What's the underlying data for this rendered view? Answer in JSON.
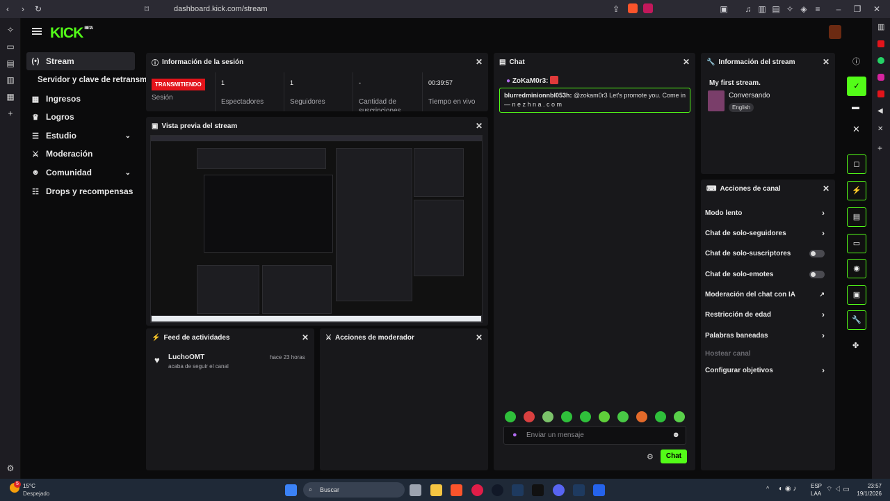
{
  "browser": {
    "url": "dashboard.kick.com/stream"
  },
  "brand": {
    "logo": "KICK",
    "badge": "BETA",
    "accent": "#53fc18"
  },
  "sidebar": {
    "items": [
      {
        "label": "Stream",
        "icon": "broadcast-icon"
      },
      {
        "label": "Servidor y clave de retransm",
        "icon": ""
      },
      {
        "label": "Ingresos",
        "icon": "chart-icon"
      },
      {
        "label": "Logros",
        "icon": "trophy-icon"
      },
      {
        "label": "Estudio",
        "icon": "sliders-icon"
      },
      {
        "label": "Moderación",
        "icon": "sword-icon"
      },
      {
        "label": "Comunidad",
        "icon": "users-icon"
      },
      {
        "label": "Drops y recompensas",
        "icon": "list-icon"
      }
    ]
  },
  "session": {
    "title": "Información de la sesión",
    "status": "TRANSMITIENDO",
    "status_label": "Sesión",
    "viewers_value": "1",
    "viewers_label": "Espectadores",
    "followers_value": "1",
    "followers_label": "Seguidores",
    "subs_value": "-",
    "subs_label": "Cantidad de suscripciones",
    "time_value": "00:39:57",
    "time_label": "Tiempo en vivo"
  },
  "preview": {
    "title": "Vista previa del stream"
  },
  "feed": {
    "title": "Feed de actividades",
    "user": "LuchoOMT",
    "action": "acaba de seguir el canal",
    "time": "hace 23 horas"
  },
  "modactions": {
    "title": "Acciones de moderador"
  },
  "chat": {
    "title": "Chat",
    "pinned_user": "ZoKaM0r3:",
    "msg_user": "blurredminionnbl053h:",
    "msg_text": "@zokam0r3 Let's promote you. Come in — n e z h n a . c o m",
    "placeholder": "Enviar un mensaje",
    "send": "Chat"
  },
  "stream_info": {
    "title": "Información del stream",
    "stream_title": "My first stream.",
    "category": "Conversando",
    "language": "English"
  },
  "channel_actions": {
    "title": "Acciones de canal",
    "items": [
      {
        "label": "Modo lento",
        "kind": "arrow"
      },
      {
        "label": "Chat de solo-seguidores",
        "kind": "arrow"
      },
      {
        "label": "Chat de solo-suscriptores",
        "kind": "toggle"
      },
      {
        "label": "Chat de solo-emotes",
        "kind": "toggle"
      },
      {
        "label": "Moderación del chat con IA",
        "kind": "external"
      },
      {
        "label": "Restricción de edad",
        "kind": "arrow"
      },
      {
        "label": "Palabras baneadas",
        "kind": "arrow"
      },
      {
        "label": "Hostear canal",
        "kind": "disabled"
      },
      {
        "label": "Configurar objetivos",
        "kind": "arrow"
      }
    ]
  },
  "taskbar": {
    "temp": "15°C",
    "weather": "Despejado",
    "search": "Buscar",
    "lang": "ESP",
    "layout": "LAA",
    "time": "23:57",
    "date": "19/1/2026",
    "notif": "5"
  }
}
